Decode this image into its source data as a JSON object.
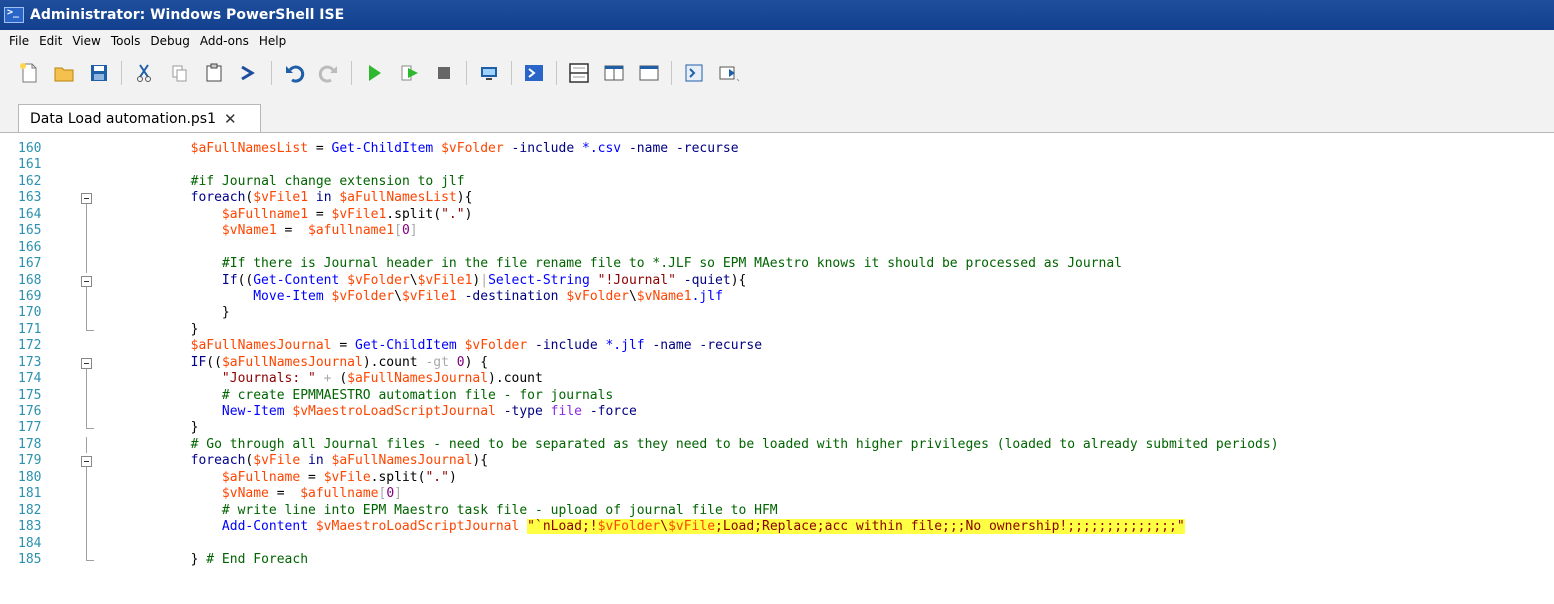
{
  "window": {
    "title": "Administrator: Windows PowerShell ISE"
  },
  "menu": [
    "File",
    "Edit",
    "View",
    "Tools",
    "Debug",
    "Add-ons",
    "Help"
  ],
  "toolbar": [
    "new-file-icon",
    "open-folder-icon",
    "save-icon",
    "cut-icon",
    "copy-icon",
    "paste-icon",
    "clear-console-icon",
    "undo-icon",
    "redo-icon",
    "run-script-icon",
    "run-selection-icon",
    "stop-icon",
    "new-remote-tab-icon",
    "start-powershell-icon",
    "show-script-top-icon",
    "show-script-right-icon",
    "show-script-max-icon",
    "show-commands-icon",
    "show-addon-icon"
  ],
  "tab": {
    "label": "Data Load automation.ps1",
    "close": "✕"
  },
  "editor": {
    "line_numbers": [
      "160",
      "161",
      "162",
      "163",
      "164",
      "165",
      "166",
      "167",
      "168",
      "169",
      "170",
      "171",
      "172",
      "173",
      "174",
      "175",
      "176",
      "177",
      "178",
      "179",
      "180",
      "181",
      "182",
      "183",
      "184",
      "185"
    ],
    "fold": [
      "none",
      "none",
      "none",
      "box",
      "line",
      "line",
      "line",
      "line",
      "box",
      "line",
      "line",
      "end",
      "none",
      "box",
      "line",
      "line",
      "line",
      "end",
      "line",
      "box",
      "line",
      "line",
      "line",
      "line",
      "line",
      "end"
    ],
    "lines": [
      [
        [
          "i8",
          ""
        ],
        [
          "var",
          "$aFullNamesList"
        ],
        [
          "p",
          " = "
        ],
        [
          "cmd",
          "Get-ChildItem"
        ],
        [
          "p",
          " "
        ],
        [
          "var",
          "$vFolder"
        ],
        [
          "p",
          " "
        ],
        [
          "param",
          "-include"
        ],
        [
          "p",
          " "
        ],
        [
          "cmd",
          "*.csv"
        ],
        [
          "p",
          " "
        ],
        [
          "param",
          "-name"
        ],
        [
          "p",
          " "
        ],
        [
          "param",
          "-recurse"
        ]
      ],
      [],
      [
        [
          "i8",
          ""
        ],
        [
          "cmt",
          "#if Journal change extension to jlf"
        ]
      ],
      [
        [
          "i8",
          ""
        ],
        [
          "kw",
          "foreach"
        ],
        [
          "p",
          "("
        ],
        [
          "var",
          "$vFile1"
        ],
        [
          "p",
          " "
        ],
        [
          "kw",
          "in"
        ],
        [
          "p",
          " "
        ],
        [
          "var",
          "$aFullNamesList"
        ],
        [
          "p",
          "){"
        ]
      ],
      [
        [
          "i12",
          ""
        ],
        [
          "var",
          "$aFullname1"
        ],
        [
          "p",
          " = "
        ],
        [
          "var",
          "$vFile1"
        ],
        [
          "p",
          "."
        ],
        [
          "p",
          "split("
        ],
        [
          "str",
          "\".\""
        ],
        [
          "p",
          ")"
        ]
      ],
      [
        [
          "i12",
          ""
        ],
        [
          "var",
          "$vName1"
        ],
        [
          "p",
          " =  "
        ],
        [
          "var",
          "$afullname1"
        ],
        [
          "op",
          "["
        ],
        [
          "num",
          "0"
        ],
        [
          "op",
          "]"
        ]
      ],
      [],
      [
        [
          "i12",
          ""
        ],
        [
          "cmt",
          "#If there is Journal header in the file rename file to *.JLF so EPM MAestro knows it should be processed as Journal"
        ]
      ],
      [
        [
          "i12",
          ""
        ],
        [
          "kw",
          "If"
        ],
        [
          "p",
          "(("
        ],
        [
          "cmd",
          "Get-Content"
        ],
        [
          "p",
          " "
        ],
        [
          "var",
          "$vFolder"
        ],
        [
          "p",
          "\\"
        ],
        [
          "var",
          "$vFile1"
        ],
        [
          "p",
          ")"
        ],
        [
          "op",
          "|"
        ],
        [
          "cmd",
          "Select-String"
        ],
        [
          "p",
          " "
        ],
        [
          "str",
          "\"!Journal\""
        ],
        [
          "p",
          " "
        ],
        [
          "param",
          "-quiet"
        ],
        [
          "p",
          "){"
        ]
      ],
      [
        [
          "i16",
          ""
        ],
        [
          "cmd",
          "Move-Item"
        ],
        [
          "p",
          " "
        ],
        [
          "var",
          "$vFolder"
        ],
        [
          "p",
          "\\"
        ],
        [
          "var",
          "$vFile1"
        ],
        [
          "p",
          " "
        ],
        [
          "param",
          "-destination"
        ],
        [
          "p",
          " "
        ],
        [
          "var",
          "$vFolder"
        ],
        [
          "p",
          "\\"
        ],
        [
          "var",
          "$vName1"
        ],
        [
          "cmd",
          ".jlf"
        ]
      ],
      [
        [
          "i12",
          ""
        ],
        [
          "p",
          "}"
        ]
      ],
      [
        [
          "i8",
          ""
        ],
        [
          "p",
          "}"
        ]
      ],
      [
        [
          "i8",
          ""
        ],
        [
          "var",
          "$aFullNamesJournal"
        ],
        [
          "p",
          " = "
        ],
        [
          "cmd",
          "Get-ChildItem"
        ],
        [
          "p",
          " "
        ],
        [
          "var",
          "$vFolder"
        ],
        [
          "p",
          " "
        ],
        [
          "param",
          "-include"
        ],
        [
          "p",
          " "
        ],
        [
          "cmd",
          "*.jlf"
        ],
        [
          "p",
          " "
        ],
        [
          "param",
          "-name"
        ],
        [
          "p",
          " "
        ],
        [
          "param",
          "-recurse"
        ]
      ],
      [
        [
          "i8",
          ""
        ],
        [
          "kw",
          "IF"
        ],
        [
          "p",
          "(("
        ],
        [
          "var",
          "$aFullNamesJournal"
        ],
        [
          "p",
          ")."
        ],
        [
          "p",
          "count"
        ],
        [
          "p",
          " "
        ],
        [
          "op",
          "-gt"
        ],
        [
          "p",
          " "
        ],
        [
          "num",
          "0"
        ],
        [
          "p",
          ") {"
        ]
      ],
      [
        [
          "i12",
          ""
        ],
        [
          "str",
          "\"Journals: \""
        ],
        [
          "p",
          " "
        ],
        [
          "op",
          "+"
        ],
        [
          "p",
          " ("
        ],
        [
          "var",
          "$aFullNamesJournal"
        ],
        [
          "p",
          ")."
        ],
        [
          "p",
          "count"
        ]
      ],
      [
        [
          "i12",
          ""
        ],
        [
          "cmt",
          "# create EPMMAESTRO automation file - for journals"
        ]
      ],
      [
        [
          "i12",
          ""
        ],
        [
          "cmd",
          "New-Item"
        ],
        [
          "p",
          " "
        ],
        [
          "var",
          "$vMaestroLoadScriptJournal"
        ],
        [
          "p",
          " "
        ],
        [
          "param",
          "-type"
        ],
        [
          "p",
          " "
        ],
        [
          "type",
          "file"
        ],
        [
          "p",
          " "
        ],
        [
          "param",
          "-force"
        ]
      ],
      [
        [
          "i8",
          ""
        ],
        [
          "p",
          "}"
        ]
      ],
      [
        [
          "i8",
          ""
        ],
        [
          "cmt",
          "# Go through all Journal files - need to be separated as they need to be loaded with higher privileges (loaded to already submited periods)"
        ]
      ],
      [
        [
          "i8",
          ""
        ],
        [
          "kw",
          "foreach"
        ],
        [
          "p",
          "("
        ],
        [
          "var",
          "$vFile"
        ],
        [
          "p",
          " "
        ],
        [
          "kw",
          "in"
        ],
        [
          "p",
          " "
        ],
        [
          "var",
          "$aFullNamesJournal"
        ],
        [
          "p",
          "){"
        ]
      ],
      [
        [
          "i12",
          ""
        ],
        [
          "var",
          "$aFullname"
        ],
        [
          "p",
          " = "
        ],
        [
          "var",
          "$vFile"
        ],
        [
          "p",
          "."
        ],
        [
          "p",
          "split("
        ],
        [
          "str",
          "\".\""
        ],
        [
          "p",
          ")"
        ]
      ],
      [
        [
          "i12",
          ""
        ],
        [
          "var",
          "$vName"
        ],
        [
          "p",
          " =  "
        ],
        [
          "var",
          "$afullname"
        ],
        [
          "op",
          "["
        ],
        [
          "num",
          "0"
        ],
        [
          "op",
          "]"
        ]
      ],
      [
        [
          "i12",
          ""
        ],
        [
          "cmt",
          "# write line into EPM Maestro task file - upload of journal file to HFM"
        ]
      ],
      [
        [
          "i12",
          ""
        ],
        [
          "cmd",
          "Add-Content"
        ],
        [
          "p",
          " "
        ],
        [
          "var",
          "$vMaestroLoadScriptJournal"
        ],
        [
          "p",
          " "
        ],
        [
          "hlstr",
          "\"`nLoad;!"
        ],
        [
          "hlvar",
          "$vFolder"
        ],
        [
          "hlstr",
          "\\"
        ],
        [
          "hlvar",
          "$vFile"
        ],
        [
          "hlstr",
          ";Load;Replace;acc within file;;;No ownership!;;;;;;;;;;;;;;\""
        ]
      ],
      [],
      [
        [
          "i8",
          ""
        ],
        [
          "p",
          "} "
        ],
        [
          "cmt",
          "# End Foreach"
        ]
      ]
    ]
  }
}
